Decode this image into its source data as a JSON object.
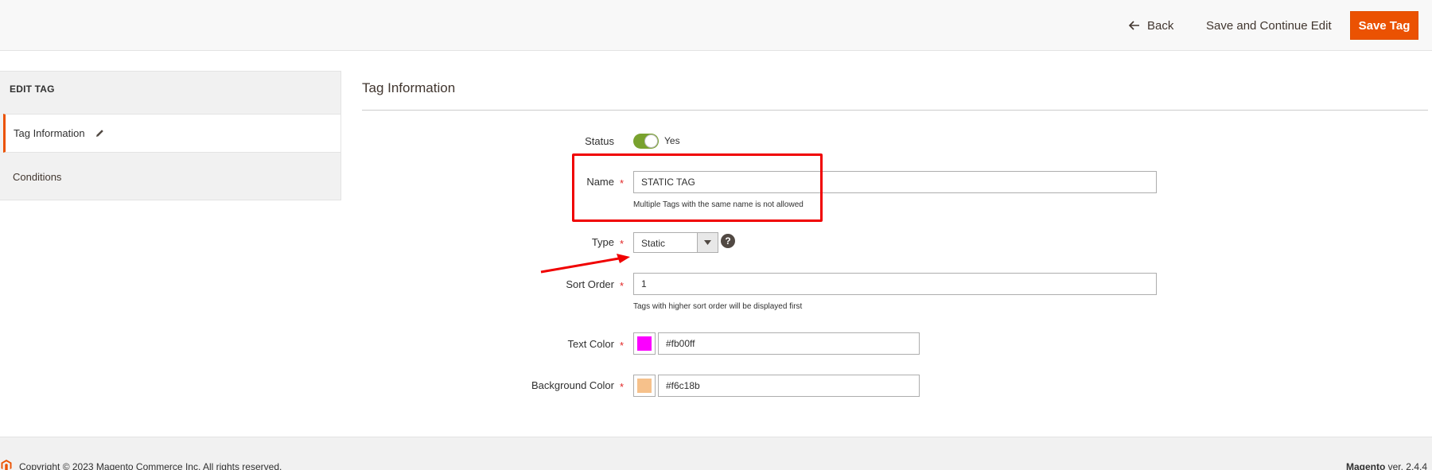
{
  "header": {
    "back_label": "Back",
    "save_continue_label": "Save and Continue Edit",
    "save_label": "Save Tag"
  },
  "sidebar": {
    "title": "EDIT TAG",
    "items": [
      {
        "label": "Tag Information",
        "active": true,
        "icon": "pencil-icon"
      },
      {
        "label": "Conditions",
        "active": false
      }
    ]
  },
  "main": {
    "section_title": "Tag Information",
    "fields": {
      "status": {
        "label": "Status",
        "value_text": "Yes",
        "enabled": true
      },
      "name": {
        "label": "Name",
        "required": "*",
        "value": "STATIC TAG",
        "note": "Multiple Tags with the same name is not allowed"
      },
      "type": {
        "label": "Type",
        "required": "*",
        "value": "Static",
        "help": "?"
      },
      "sort_order": {
        "label": "Sort Order",
        "required": "*",
        "value": "1",
        "note": "Tags with higher sort order will be displayed first"
      },
      "text_color": {
        "label": "Text Color",
        "required": "*",
        "value": "#fb00ff",
        "swatch": "#fb00ff"
      },
      "background_color": {
        "label": "Background Color",
        "required": "*",
        "value": "#f6c18b",
        "swatch": "#f6c18b"
      }
    }
  },
  "footer": {
    "copyright": "Copyright © 2023 Magento Commerce Inc. All rights reserved.",
    "brand": "Magento",
    "version": " ver. 2.4.4"
  },
  "colors": {
    "accent": "#eb5202",
    "toggle_on": "#79a22e",
    "annotation": "#f00000"
  }
}
